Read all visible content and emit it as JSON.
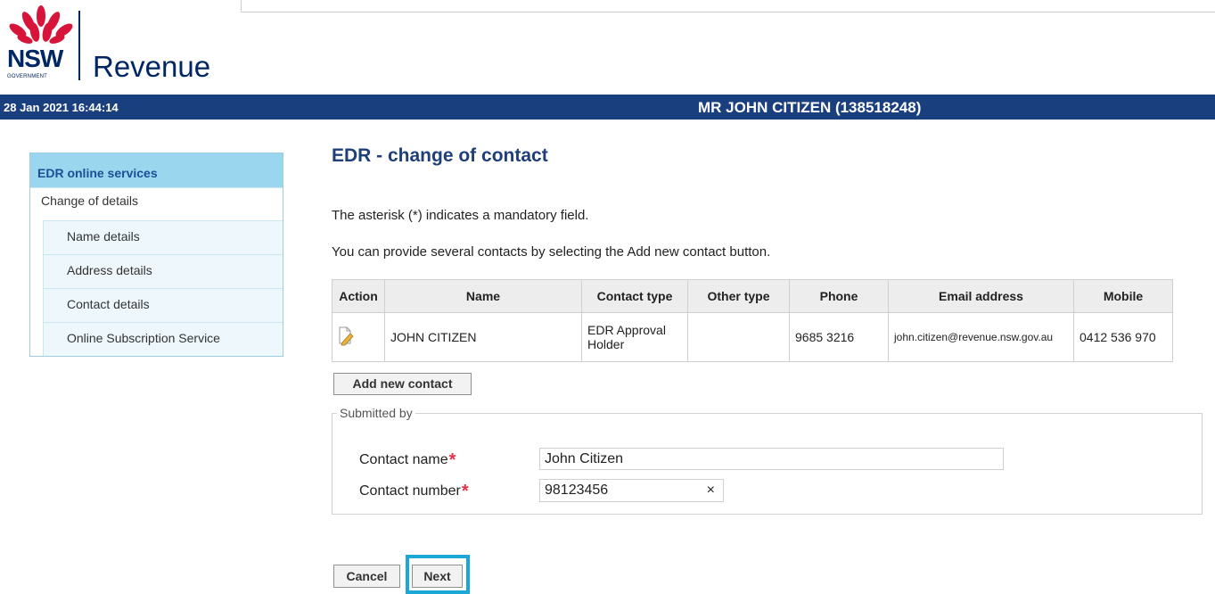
{
  "header": {
    "logo_nsw": "NSW",
    "logo_government": "GOVERNMENT",
    "logo_agency": "Revenue",
    "datetime": "28 Jan 2021 16:44:14",
    "user": "MR JOHN CITIZEN (138518248)"
  },
  "sidebar": {
    "heading": "EDR online services",
    "items": [
      {
        "label": "Change of details"
      },
      {
        "label": "Name details"
      },
      {
        "label": "Address details"
      },
      {
        "label": "Contact details"
      },
      {
        "label": "Online Subscription Service"
      }
    ]
  },
  "main": {
    "title": "EDR - change of contact",
    "mandatory_note": "The asterisk (*) indicates a mandatory field.",
    "multi_contact_note": "You can provide several contacts by selecting the Add new contact button.",
    "table": {
      "columns": [
        "Action",
        "Name",
        "Contact type",
        "Other type",
        "Phone",
        "Email address",
        "Mobile"
      ],
      "rows": [
        {
          "action_icon": "edit-icon",
          "name": "JOHN CITIZEN",
          "contact_type": "EDR Approval Holder",
          "other_type": "",
          "phone": "9685 3216",
          "email": "john.citizen@revenue.nsw.gov.au",
          "mobile": "0412 536 970"
        }
      ]
    },
    "add_contact_label": "Add new contact",
    "submitted_by": {
      "legend": "Submitted by",
      "contact_name_label": "Contact name",
      "contact_name_value": "John Citizen",
      "contact_number_label": "Contact number",
      "contact_number_value": "98123456",
      "clear_glyph": "×"
    },
    "cancel_label": "Cancel",
    "next_label": "Next"
  },
  "colors": {
    "brand_navy": "#002664",
    "header_bar": "#1a3f7f",
    "sidebar_head": "#9ad6ee",
    "required_star": "#e0334a",
    "highlight": "#1ba8d6",
    "waratah_red": "#d7153a"
  }
}
